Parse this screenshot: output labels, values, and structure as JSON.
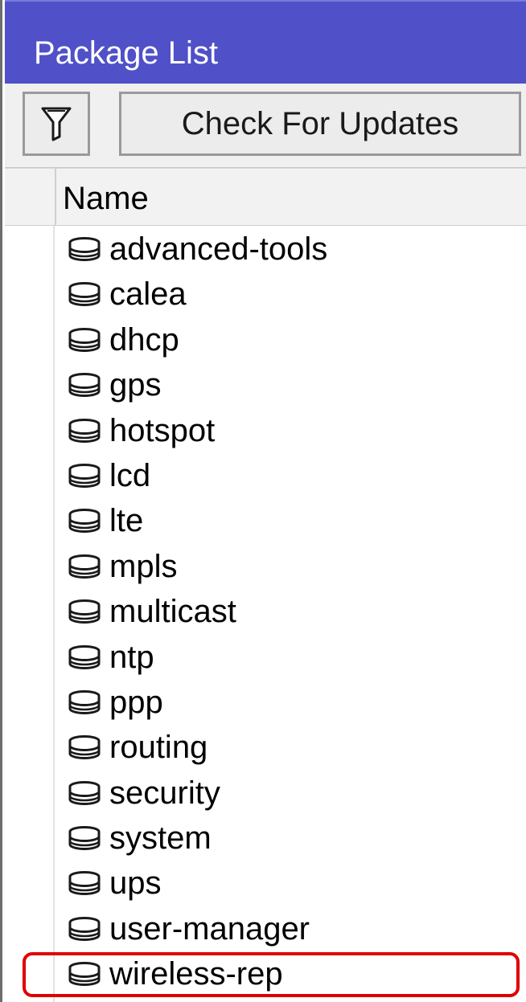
{
  "window": {
    "title": "Package List"
  },
  "toolbar": {
    "filter_icon": "filter-funnel-icon",
    "check_updates_label": "Check For Updates"
  },
  "table": {
    "columns": [
      "Name"
    ],
    "row_icon": "package-icon",
    "rows": [
      {
        "name": "advanced-tools"
      },
      {
        "name": "calea"
      },
      {
        "name": "dhcp"
      },
      {
        "name": "gps"
      },
      {
        "name": "hotspot"
      },
      {
        "name": "lcd"
      },
      {
        "name": "lte"
      },
      {
        "name": "mpls"
      },
      {
        "name": "multicast"
      },
      {
        "name": "ntp"
      },
      {
        "name": "ppp"
      },
      {
        "name": "routing"
      },
      {
        "name": "security"
      },
      {
        "name": "system"
      },
      {
        "name": "ups"
      },
      {
        "name": "user-manager"
      },
      {
        "name": "wireless-rep",
        "highlighted": true
      }
    ]
  },
  "colors": {
    "titlebar": "#5050c8",
    "highlight_outline": "#e00000"
  }
}
